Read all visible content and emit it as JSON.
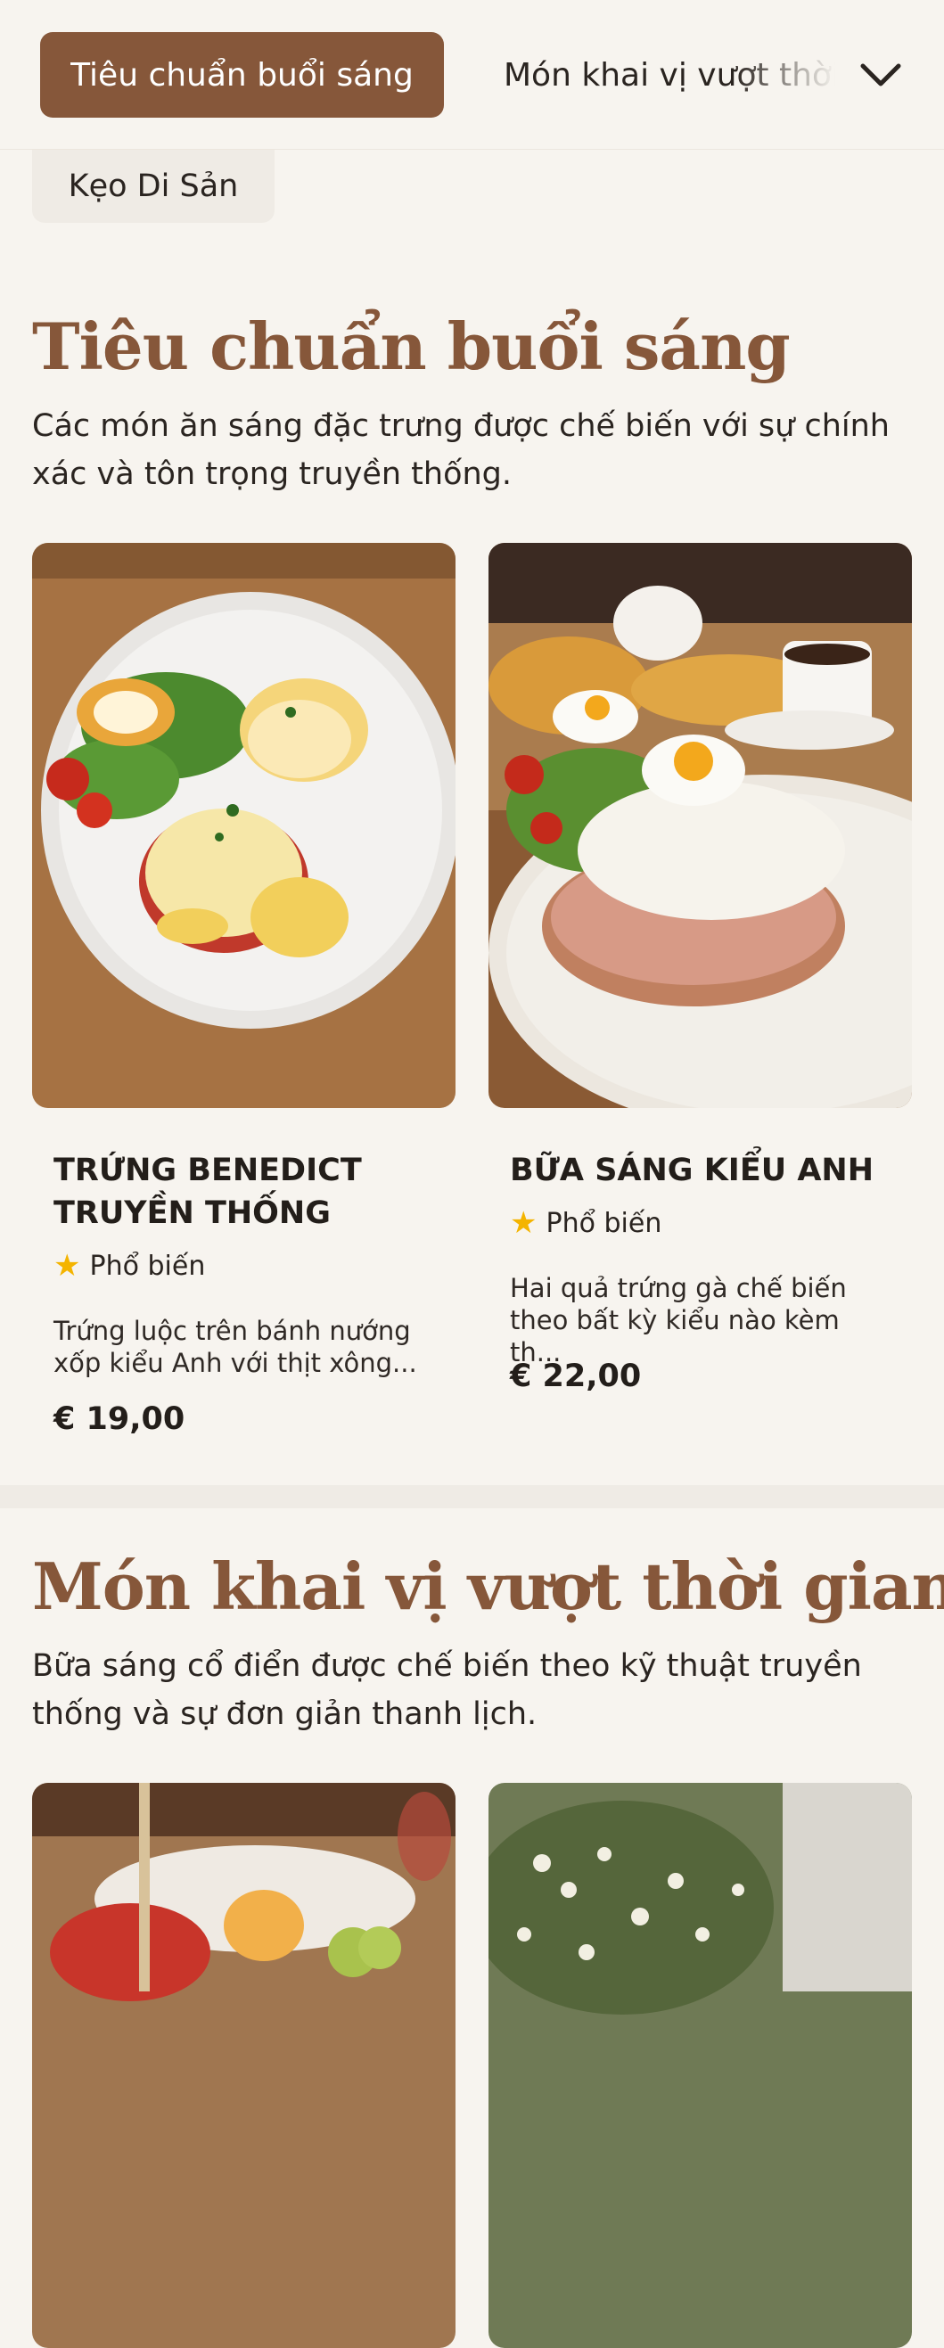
{
  "nav": {
    "active_tab": "Tiêu chuẩn buổi sáng",
    "next_tab": "Món khai vị vượt thời gian",
    "second_row_tab": "Kẹo Di Sản",
    "expand_icon": "chevron-down-icon"
  },
  "sections": [
    {
      "title": "Tiêu chuẩn buổi sáng",
      "description": "Các món ăn sáng đặc trưng được chế biến với sự chính xác và tôn trọng truyền thống.",
      "items": [
        {
          "name": "TRỨNG BENEDICT TRUYỀN THỐNG",
          "badge": "Phổ biến",
          "description": "Trứng luộc trên bánh nướng xốp kiểu Anh với thịt xông...",
          "price": "€ 19,00"
        },
        {
          "name": "BỮA SÁNG KIỂU ANH",
          "badge": "Phổ biến",
          "description": "Hai quả trứng gà chế biến theo bất kỳ kiểu nào kèm th...",
          "price": "€ 22,00"
        }
      ]
    },
    {
      "title": "Món khai vị vượt thời gian",
      "description": "Bữa sáng cổ điển được chế biến theo kỹ thuật truyền thống và sự đơn giản thanh lịch."
    }
  ],
  "colors": {
    "accent": "#86573a",
    "background": "#f7f4ef",
    "star": "#f4b400"
  }
}
